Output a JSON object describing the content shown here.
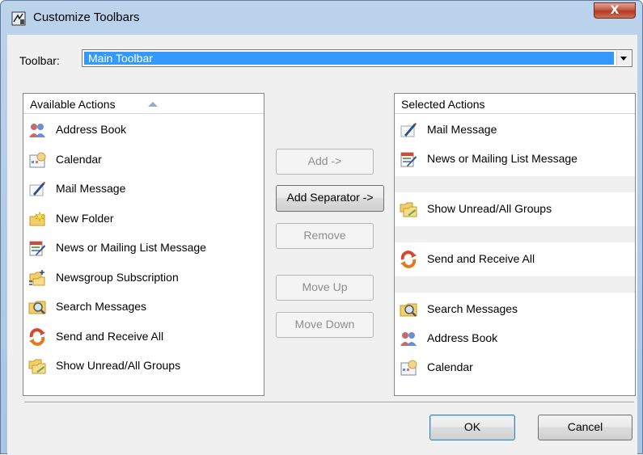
{
  "window": {
    "title": "Customize Toolbars",
    "close_label": "X"
  },
  "toolbar": {
    "label": "Toolbar:",
    "selected_value": "Main Toolbar"
  },
  "available": {
    "header": "Available Actions",
    "items": [
      {
        "label": "Address Book",
        "icon": "address-book-icon"
      },
      {
        "label": "Calendar",
        "icon": "calendar-icon"
      },
      {
        "label": "Mail Message",
        "icon": "mail-message-icon"
      },
      {
        "label": "New Folder",
        "icon": "new-folder-icon"
      },
      {
        "label": "News or Mailing List Message",
        "icon": "news-message-icon"
      },
      {
        "label": "Newsgroup Subscription",
        "icon": "newsgroup-subscription-icon"
      },
      {
        "label": "Search Messages",
        "icon": "search-messages-icon"
      },
      {
        "label": "Send and Receive All",
        "icon": "send-receive-icon"
      },
      {
        "label": "Show Unread/All Groups",
        "icon": "show-unread-icon"
      }
    ]
  },
  "selected": {
    "header": "Selected Actions",
    "items": [
      {
        "label": "Mail Message",
        "icon": "mail-message-icon"
      },
      {
        "label": "News or Mailing List Message",
        "icon": "news-message-icon"
      },
      {
        "label": "",
        "icon": "separator"
      },
      {
        "label": "Show Unread/All Groups",
        "icon": "show-unread-icon"
      },
      {
        "label": "",
        "icon": "separator"
      },
      {
        "label": "Send and Receive All",
        "icon": "send-receive-icon"
      },
      {
        "label": "",
        "icon": "separator"
      },
      {
        "label": "Search Messages",
        "icon": "search-messages-icon"
      },
      {
        "label": "Address Book",
        "icon": "address-book-icon"
      },
      {
        "label": "Calendar",
        "icon": "calendar-icon"
      }
    ]
  },
  "buttons": {
    "add": "Add ->",
    "add_separator": "Add Separator ->",
    "remove": "Remove",
    "move_up": "Move Up",
    "move_down": "Move Down",
    "ok": "OK",
    "cancel": "Cancel"
  },
  "colors": {
    "selection": "#3399ff",
    "title_bar": "#bcd3ec",
    "close_button": "#c45a43"
  }
}
